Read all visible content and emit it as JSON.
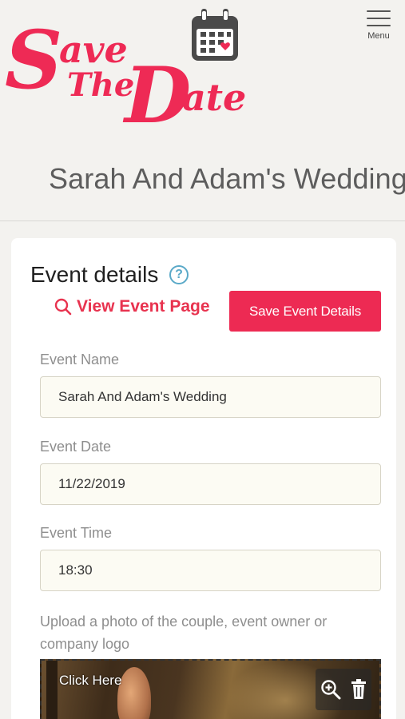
{
  "header": {
    "logo_text": "Save The Date",
    "menu_label": "Menu"
  },
  "page_title": "Sarah And Adam's Wedding",
  "event_details": {
    "title": "Event details",
    "help_icon": "question-circle-icon",
    "view_link": "View Event Page",
    "save_button": "Save Event Details",
    "fields": [
      {
        "label": "Event Name",
        "value": "Sarah And Adam's Wedding"
      },
      {
        "label": "Event Date",
        "value": "11/22/2019"
      },
      {
        "label": "Event Time",
        "value": "18:30"
      }
    ],
    "upload_label": "Upload a photo of the couple, event owner or company logo",
    "photo": {
      "click_text": "Click Here",
      "zoom_icon": "zoom-in-icon",
      "delete_icon": "trash-icon"
    }
  },
  "colors": {
    "brand": "#ed2a53",
    "link": "#e8334f",
    "help": "#5aa9c8",
    "background": "#f3f2ef"
  }
}
